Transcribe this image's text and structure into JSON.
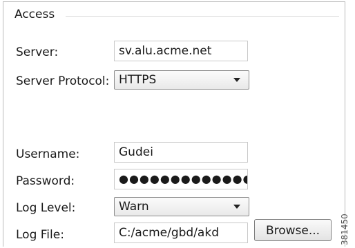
{
  "group": {
    "title": "Access"
  },
  "form": {
    "server": {
      "label": "Server:",
      "value": "sv.alu.acme.net"
    },
    "protocol": {
      "label": "Server Protocol:",
      "value": "HTTPS"
    },
    "username": {
      "label": "Username:",
      "value": "Gudei"
    },
    "password": {
      "label": "Password:",
      "value": "●●●●●●●●●●●●●"
    },
    "log_level": {
      "label": "Log Level:",
      "value": "Warn"
    },
    "log_file": {
      "label": "Log File:",
      "value": "C:/acme/gbd/akd",
      "browse_label": "Browse..."
    }
  },
  "figure_id": "381450",
  "icons": {
    "dropdown": "chevron-down-icon"
  },
  "colors": {
    "border": "#b9b9b9",
    "text": "#1a1a1a",
    "field_border": "#c8c8c8",
    "button_gradient_top": "#fafafa",
    "button_gradient_bottom": "#e3e3e3"
  }
}
